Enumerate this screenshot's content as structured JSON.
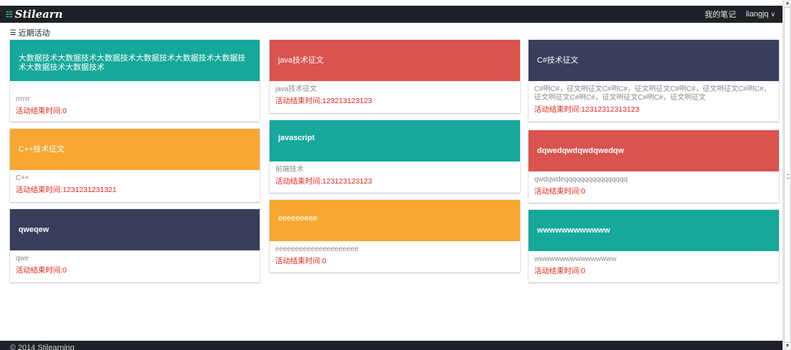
{
  "navbar": {
    "brand": "Stilearn",
    "brand_icon": "grid-logo-icon",
    "my_notes": "我的笔记",
    "user": "liangjq",
    "user_menu_icon": "chevron-down-icon"
  },
  "section": {
    "title": "近期活动",
    "icon": "rss-icon"
  },
  "cards": [
    {
      "title": "大数据技术大数据技术大数据技术大数据技术大数据技术大数据技术大数据技术大数据技术",
      "desc": "rrrrrr",
      "time": "活动结束时间:0",
      "color": "#15a89b"
    },
    {
      "title": "C++技术征文",
      "desc": "C++",
      "time": "活动结束时间:1231231231321",
      "color": "#f8a733"
    },
    {
      "title": "qweqew",
      "desc": "qwe",
      "time": "活动结束时间:0",
      "color": "#393e5c"
    },
    {
      "title": "java技术征文",
      "desc": "java技术征文",
      "time": "活动结束时间:123213123123",
      "color": "#d9534f"
    },
    {
      "title": "javascript",
      "desc": "前端技术",
      "time": "活动结束时间:123123123123",
      "color": "#15a89b"
    },
    {
      "title": "eeeeeeeee",
      "desc": "eeeeeeeeeeeeeeeeeeeee",
      "time": "活动结束时间:0",
      "color": "#f8a733"
    },
    {
      "title": "C#技术征文",
      "desc": "C#咧C#，征文咧征文C#咧C#，征文咧征文C#咧C#，征文咧征文C#咧C#，征文咧征文C#咧C#，征文咧征文C#咧C#，征文咧征文",
      "time": "活动结束时间:12312312313123",
      "color": "#393e5c"
    },
    {
      "title": "dqwedqwdqwdqwedqw",
      "desc": "qwdqwdeqqqqqqqqqqqqqqqq",
      "time": "活动结束时间:0",
      "color": "#d9534f"
    },
    {
      "title": "wwwwwwwwwwww",
      "desc": "wwwwwwwwwwwwwwww",
      "time": "活动结束时间:0",
      "color": "#15a89b"
    }
  ],
  "footer": {
    "copyright": "© 2014 Stilearning"
  }
}
